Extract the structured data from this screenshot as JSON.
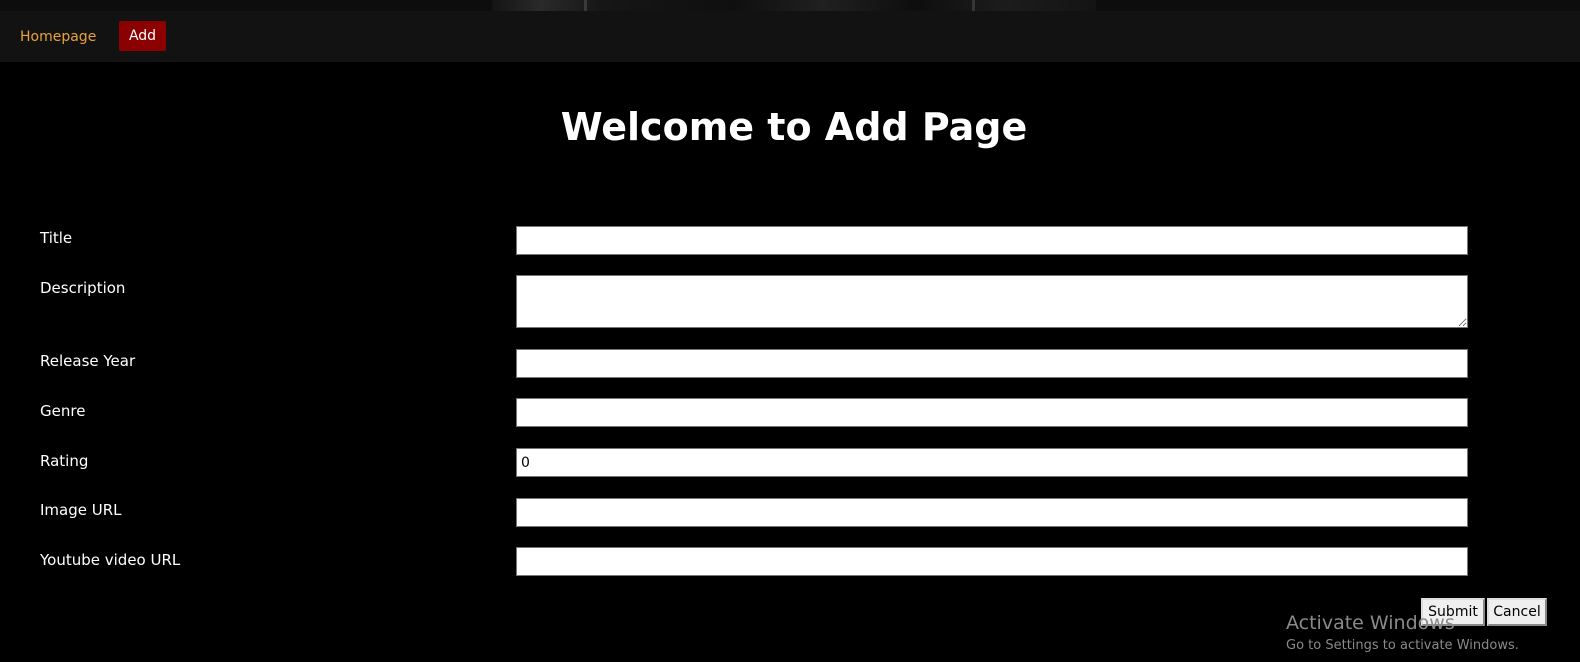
{
  "nav": {
    "home_label": "Homepage",
    "add_label": "Add"
  },
  "page": {
    "title": "Welcome to Add Page"
  },
  "form": {
    "fields": [
      {
        "label": "Title",
        "value": ""
      },
      {
        "label": "Description",
        "value": ""
      },
      {
        "label": "Release Year",
        "value": ""
      },
      {
        "label": "Genre",
        "value": ""
      },
      {
        "label": "Rating",
        "value": "0"
      },
      {
        "label": "Image URL",
        "value": ""
      },
      {
        "label": "Youtube video URL",
        "value": ""
      }
    ],
    "submit_label": "Submit",
    "cancel_label": "Cancel"
  },
  "watermark": {
    "title": "Activate Windows",
    "subtitle": "Go to Settings to activate Windows."
  },
  "colors": {
    "background": "#000000",
    "navbar": "#121212",
    "home_link": "#e8a33b",
    "add_button": "#8b0000"
  }
}
